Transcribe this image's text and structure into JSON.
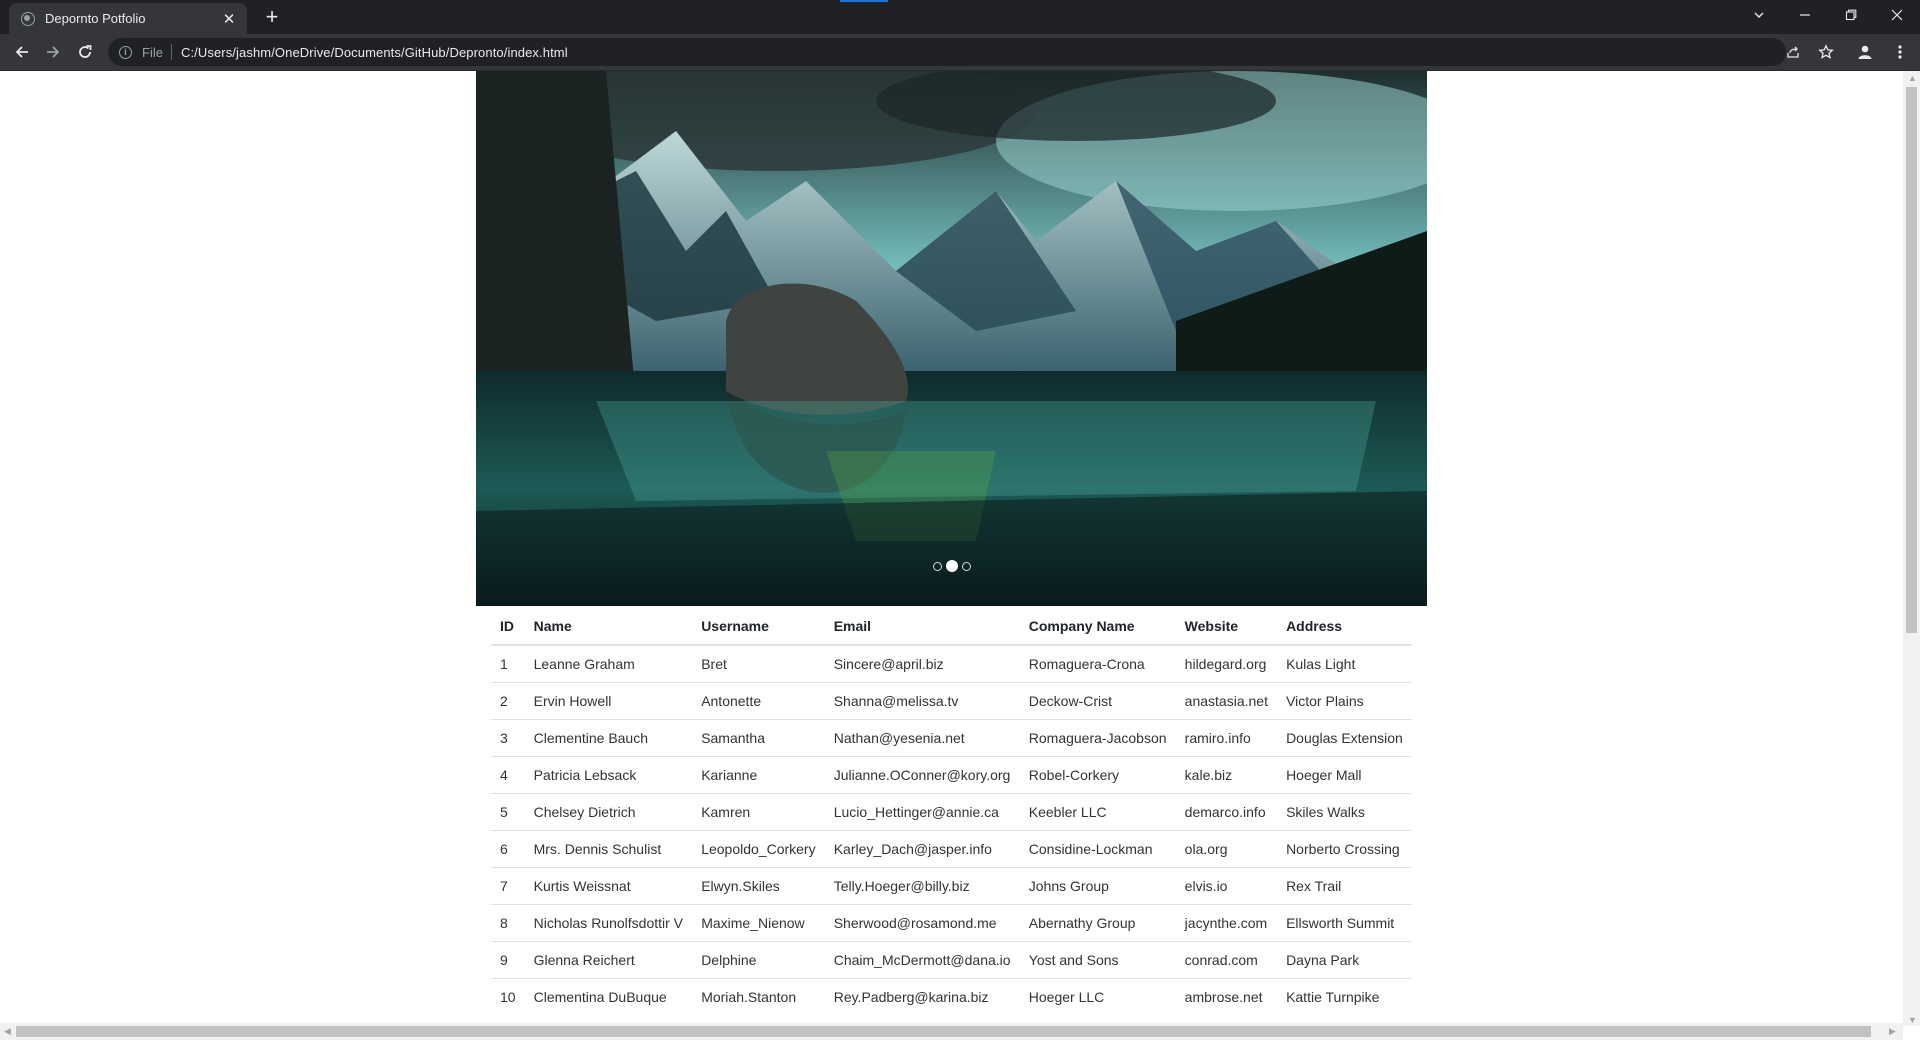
{
  "browser": {
    "tab_title": "Depornto Potfolio",
    "url_scheme_label": "File",
    "url": "C:/Users/jashm/OneDrive/Documents/GitHub/Depronto/index.html",
    "accent": "#1a73e8"
  },
  "carousel": {
    "slide_count": 3,
    "active_index": 1
  },
  "table": {
    "headers": [
      "ID",
      "Name",
      "Username",
      "Email",
      "Company Name",
      "Website",
      "Address"
    ],
    "rows": [
      [
        "1",
        "Leanne Graham",
        "Bret",
        "Sincere@april.biz",
        "Romaguera-Crona",
        "hildegard.org",
        "Kulas Light"
      ],
      [
        "2",
        "Ervin Howell",
        "Antonette",
        "Shanna@melissa.tv",
        "Deckow-Crist",
        "anastasia.net",
        "Victor Plains"
      ],
      [
        "3",
        "Clementine Bauch",
        "Samantha",
        "Nathan@yesenia.net",
        "Romaguera-Jacobson",
        "ramiro.info",
        "Douglas Extension"
      ],
      [
        "4",
        "Patricia Lebsack",
        "Karianne",
        "Julianne.OConner@kory.org",
        "Robel-Corkery",
        "kale.biz",
        "Hoeger Mall"
      ],
      [
        "5",
        "Chelsey Dietrich",
        "Kamren",
        "Lucio_Hettinger@annie.ca",
        "Keebler LLC",
        "demarco.info",
        "Skiles Walks"
      ],
      [
        "6",
        "Mrs. Dennis Schulist",
        "Leopoldo_Corkery",
        "Karley_Dach@jasper.info",
        "Considine-Lockman",
        "ola.org",
        "Norberto Crossing"
      ],
      [
        "7",
        "Kurtis Weissnat",
        "Elwyn.Skiles",
        "Telly.Hoeger@billy.biz",
        "Johns Group",
        "elvis.io",
        "Rex Trail"
      ],
      [
        "8",
        "Nicholas Runolfsdottir V",
        "Maxime_Nienow",
        "Sherwood@rosamond.me",
        "Abernathy Group",
        "jacynthe.com",
        "Ellsworth Summit"
      ],
      [
        "9",
        "Glenna Reichert",
        "Delphine",
        "Chaim_McDermott@dana.io",
        "Yost and Sons",
        "conrad.com",
        "Dayna Park"
      ],
      [
        "10",
        "Clementina DuBuque",
        "Moriah.Stanton",
        "Rey.Padberg@karina.biz",
        "Hoeger LLC",
        "ambrose.net",
        "Kattie Turnpike"
      ]
    ]
  }
}
